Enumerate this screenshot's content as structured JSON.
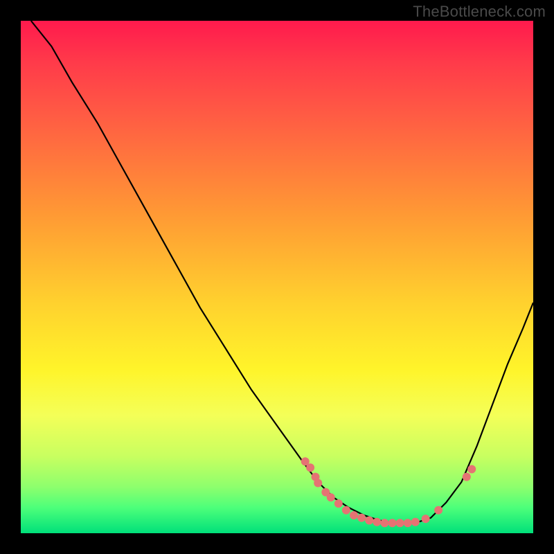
{
  "watermark": "TheBottleneck.com",
  "chart_data": {
    "type": "line",
    "title": "",
    "xlabel": "",
    "ylabel": "",
    "xlim": [
      0,
      1
    ],
    "ylim": [
      0,
      1
    ],
    "series": [
      {
        "name": "curve",
        "x": [
          0.02,
          0.06,
          0.1,
          0.15,
          0.2,
          0.25,
          0.3,
          0.35,
          0.4,
          0.45,
          0.5,
          0.55,
          0.58,
          0.61,
          0.64,
          0.67,
          0.7,
          0.73,
          0.77,
          0.8,
          0.83,
          0.86,
          0.89,
          0.92,
          0.95,
          0.98,
          1.0
        ],
        "y": [
          1.0,
          0.95,
          0.88,
          0.8,
          0.71,
          0.62,
          0.53,
          0.44,
          0.36,
          0.28,
          0.21,
          0.14,
          0.1,
          0.07,
          0.05,
          0.035,
          0.025,
          0.02,
          0.02,
          0.03,
          0.06,
          0.1,
          0.17,
          0.25,
          0.33,
          0.4,
          0.45
        ]
      }
    ],
    "markers": [
      {
        "x": 0.555,
        "y": 0.14
      },
      {
        "x": 0.565,
        "y": 0.128
      },
      {
        "x": 0.575,
        "y": 0.11
      },
      {
        "x": 0.58,
        "y": 0.098
      },
      {
        "x": 0.595,
        "y": 0.08
      },
      {
        "x": 0.605,
        "y": 0.07
      },
      {
        "x": 0.62,
        "y": 0.058
      },
      {
        "x": 0.635,
        "y": 0.045
      },
      {
        "x": 0.65,
        "y": 0.035
      },
      {
        "x": 0.665,
        "y": 0.03
      },
      {
        "x": 0.68,
        "y": 0.025
      },
      {
        "x": 0.695,
        "y": 0.022
      },
      {
        "x": 0.71,
        "y": 0.02
      },
      {
        "x": 0.725,
        "y": 0.02
      },
      {
        "x": 0.74,
        "y": 0.02
      },
      {
        "x": 0.755,
        "y": 0.02
      },
      {
        "x": 0.77,
        "y": 0.022
      },
      {
        "x": 0.79,
        "y": 0.028
      },
      {
        "x": 0.815,
        "y": 0.045
      },
      {
        "x": 0.87,
        "y": 0.11
      },
      {
        "x": 0.88,
        "y": 0.125
      }
    ]
  }
}
